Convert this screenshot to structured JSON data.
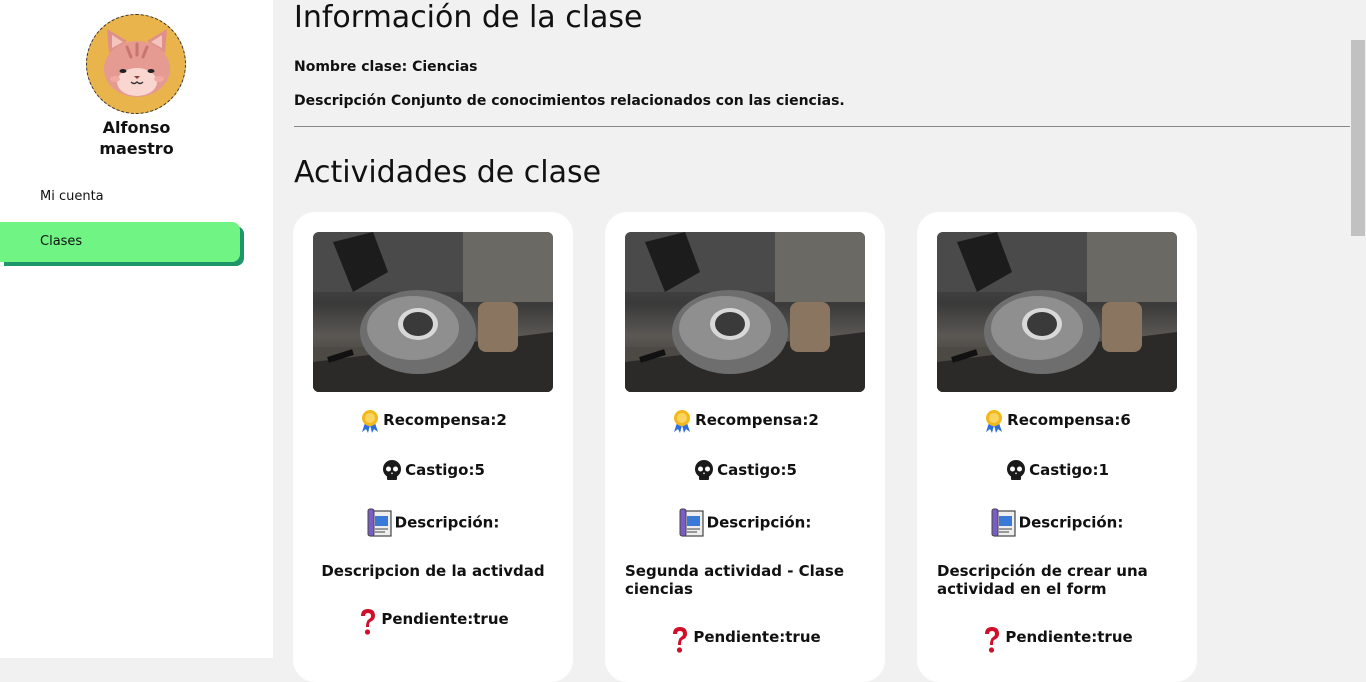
{
  "sidebar": {
    "user": {
      "name": "Alfonso",
      "role": "maestro"
    },
    "nav": [
      {
        "label": "Mi cuenta",
        "active": false
      },
      {
        "label": "Clases",
        "active": true
      }
    ],
    "accent_color": "#70f584",
    "accent_shadow": "#1f9669"
  },
  "main": {
    "title": "Información de la clase",
    "name_label": "Nombre clase:",
    "name_value": "Ciencias",
    "desc_label": "Descripción",
    "desc_value": "Conjunto de conocimientos relacionados con las ciencias.",
    "activities_title": "Actividades de clase",
    "labels": {
      "reward": "Recompensa",
      "punishment": "Castigo",
      "description": "Descripción:",
      "pending": "Pendiente"
    },
    "icons": [
      "medal-icon",
      "skull-icon",
      "document-icon",
      "question-icon"
    ],
    "activities": [
      {
        "reward": "2",
        "punishment": "5",
        "description": "Descripcion de la activdad",
        "pending": "true"
      },
      {
        "reward": "2",
        "punishment": "5",
        "description": "Segunda actividad - Clase ciencias",
        "pending": "true"
      },
      {
        "reward": "6",
        "punishment": "1",
        "description": "Descripción de crear una actividad en el form",
        "pending": "true"
      }
    ]
  }
}
